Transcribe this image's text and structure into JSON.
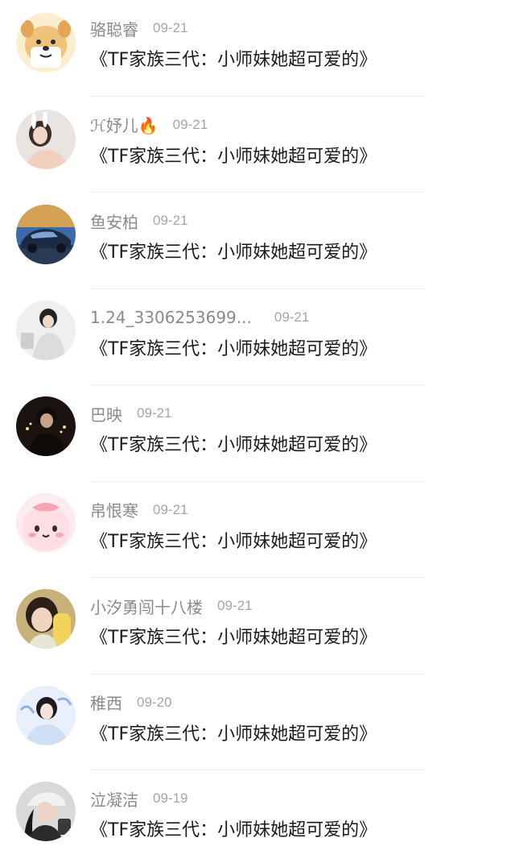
{
  "comments": [
    {
      "name": "骆聪睿",
      "date": "09-21",
      "title": "《TF家族三代：小师妹她超可爱的》",
      "avatar_icon": "cartoon-dog-avatar"
    },
    {
      "name": "ℋ妤儿🔥",
      "date": "09-21",
      "title": "《TF家族三代：小师妹她超可爱的》",
      "avatar_icon": "girl-photo-avatar"
    },
    {
      "name": "鱼安柏",
      "date": "09-21",
      "title": "《TF家族三代：小师妹她超可爱的》",
      "avatar_icon": "car-photo-avatar"
    },
    {
      "name": "1.24_3306253699...",
      "date": "09-21",
      "title": "《TF家族三代：小师妹她超可爱的》",
      "avatar_icon": "person-photo-avatar"
    },
    {
      "name": "巴映",
      "date": "09-21",
      "title": "《TF家族三代：小师妹她超可爱的》",
      "avatar_icon": "night-photo-avatar"
    },
    {
      "name": "帛恨寒",
      "date": "09-21",
      "title": "《TF家族三代：小师妹她超可爱的》",
      "avatar_icon": "pink-cartoon-avatar"
    },
    {
      "name": "小汐勇闯十八楼",
      "date": "09-21",
      "title": "《TF家族三代：小师妹她超可爱的》",
      "avatar_icon": "girl-corn-photo-avatar"
    },
    {
      "name": "稚西",
      "date": "09-20",
      "title": "《TF家族三代：小师妹她超可爱的》",
      "avatar_icon": "girl-blue-photo-avatar"
    },
    {
      "name": "泣凝洁",
      "date": "09-19",
      "title": "《TF家族三代：小师妹她超可爱的》",
      "avatar_icon": "girl-cap-photo-avatar"
    }
  ]
}
